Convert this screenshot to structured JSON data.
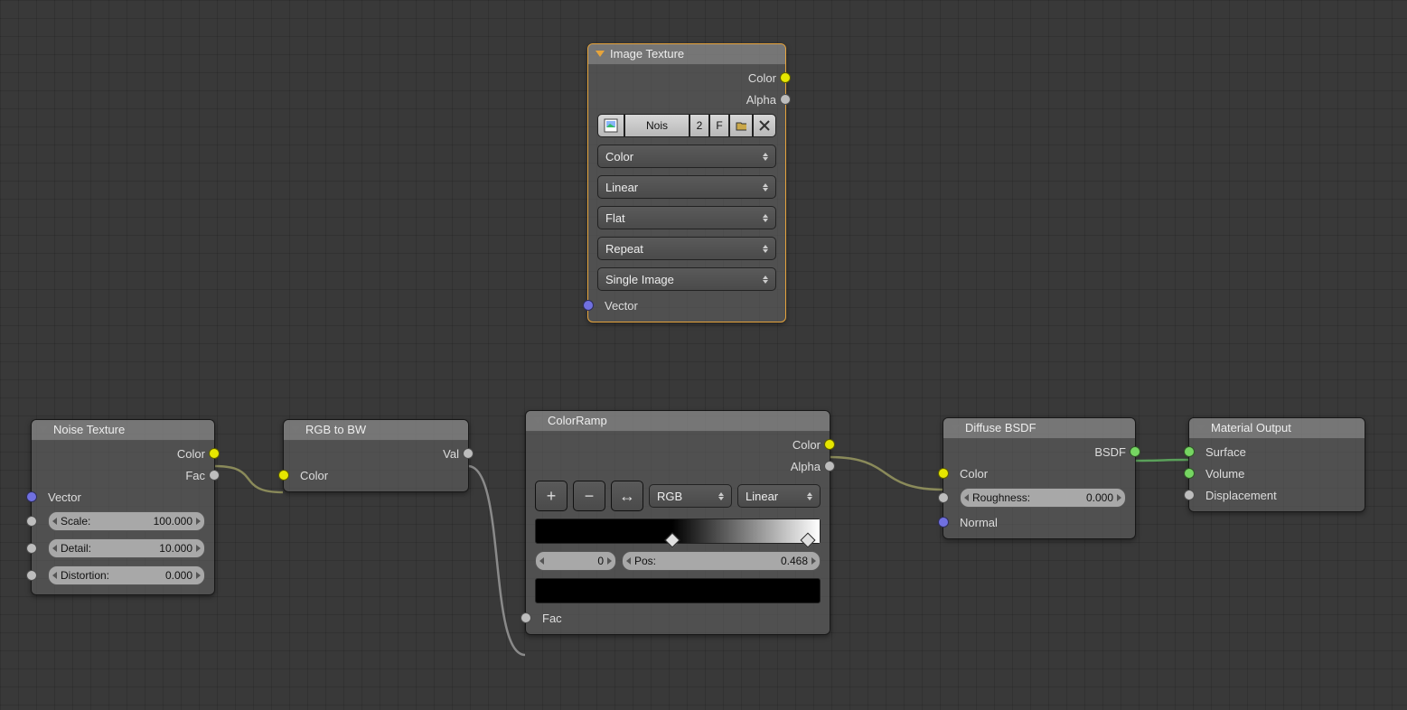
{
  "image_texture": {
    "title": "Image Texture",
    "out_color": "Color",
    "out_alpha": "Alpha",
    "datablock_name": "Nois",
    "datablock_users": "2",
    "datablock_fake": "F",
    "colorspace": "Color",
    "interpolation": "Linear",
    "projection": "Flat",
    "extension": "Repeat",
    "source": "Single Image",
    "in_vector": "Vector"
  },
  "noise_texture": {
    "title": "Noise Texture",
    "out_color": "Color",
    "out_fac": "Fac",
    "in_vector": "Vector",
    "scale_label": "Scale:",
    "scale_value": "100.000",
    "detail_label": "Detail:",
    "detail_value": "10.000",
    "distortion_label": "Distortion:",
    "distortion_value": "0.000"
  },
  "rgb_to_bw": {
    "title": "RGB to BW",
    "out_val": "Val",
    "in_color": "Color"
  },
  "color_ramp": {
    "title": "ColorRamp",
    "out_color": "Color",
    "out_alpha": "Alpha",
    "mode": "RGB",
    "interp": "Linear",
    "index_value": "0",
    "pos_label": "Pos:",
    "pos_value": "0.468",
    "in_fac": "Fac"
  },
  "diffuse": {
    "title": "Diffuse BSDF",
    "out_bsdf": "BSDF",
    "in_color": "Color",
    "roughness_label": "Roughness:",
    "roughness_value": "0.000",
    "in_normal": "Normal"
  },
  "material_output": {
    "title": "Material Output",
    "in_surface": "Surface",
    "in_volume": "Volume",
    "in_displacement": "Displacement"
  }
}
